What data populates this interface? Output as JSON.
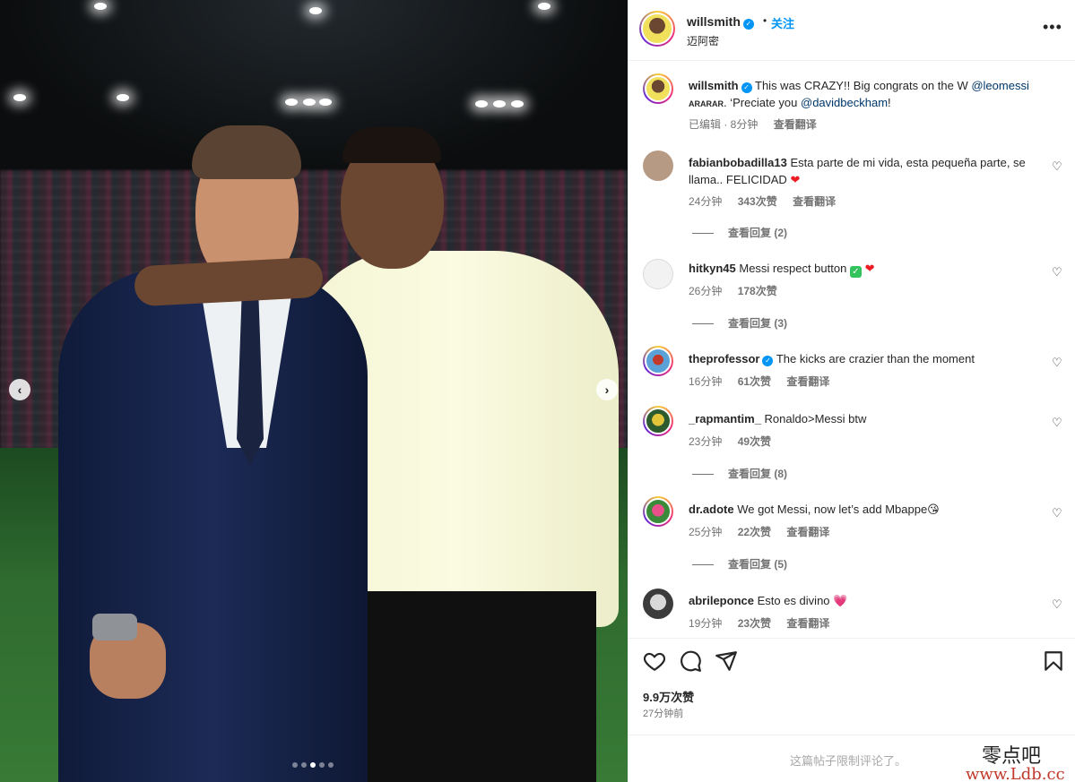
{
  "media": {
    "nav_prev": "‹",
    "nav_next": "›",
    "carousel_dots": 5,
    "active_dot": 3
  },
  "header": {
    "username": "willsmith",
    "dot": "•",
    "follow_label": "关注",
    "location": "迈阿密",
    "more_icon": "more-horizontal-icon"
  },
  "caption": {
    "username": "willsmith",
    "text_1": "This was CRAZY!! Big congrats on the W",
    "mention_1": "@leomessi",
    "text_2_small": "ARARAR",
    "text_2": ". ‘Preciate you",
    "mention_2": "@davidbeckham",
    "text_3": "!",
    "meta_edited": "已编辑 · 8分钟",
    "meta_translate": "查看翻译"
  },
  "comments": [
    {
      "username": "fabianbobadilla13",
      "text": "Esta parte de mi vida, esta pequeña parte, se llama.. FELICIDAD",
      "emoji": "❤",
      "time": "24分钟",
      "likes": "343次赞",
      "translate": "查看翻译",
      "replies": "查看回复 (2)"
    },
    {
      "username": "hitkyn45",
      "text": "Messi respect button",
      "emoji_check": "✓",
      "emoji": "❤",
      "time": "26分钟",
      "likes": "178次赞",
      "replies": "查看回复 (3)"
    },
    {
      "username": "theprofessor",
      "text": "The kicks are crazier than the moment",
      "time": "16分钟",
      "likes": "61次赞",
      "translate": "查看翻译"
    },
    {
      "username": "_rapmantim_",
      "text": "Ronaldo>Messi btw",
      "time": "23分钟",
      "likes": "49次赞",
      "replies": "查看回复 (8)"
    },
    {
      "username": "dr.adote",
      "text": "We got Messi, now let’s add Mbappe",
      "emoji": "😘",
      "time": "25分钟",
      "likes": "22次赞",
      "translate": "查看翻译",
      "replies": "查看回复 (5)"
    },
    {
      "username": "abrileponce",
      "text": "Esto es divino",
      "emoji": "💗",
      "time": "19分钟",
      "likes": "23次赞",
      "translate": "查看翻译"
    }
  ],
  "actions": {
    "likes": "9.9万次赞",
    "posted": "27分钟前"
  },
  "footer": {
    "limited": "这篇帖子限制评论了。",
    "watermark_cn": "零点吧",
    "watermark_url": "www.Ldb.cc"
  }
}
